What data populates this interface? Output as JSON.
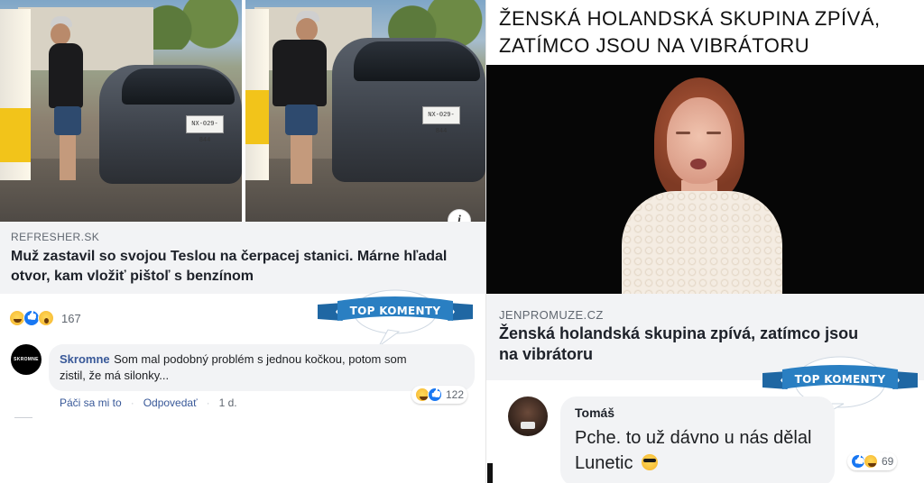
{
  "left_post": {
    "link": {
      "source": "REFRESHER.SK",
      "headline": "Muž zastavil so svojou Teslou na čerpacej stanici. Márne hľadal otvor, kam vložiť pištoľ s benzínom"
    },
    "photo": {
      "plate_left": "NX-029-844",
      "plate_right": "NX-029-844"
    },
    "info_icon": "i",
    "reactions": {
      "icons": [
        "haha-reaction-icon",
        "like-reaction-icon",
        "wow-reaction-icon"
      ],
      "count": "167"
    },
    "top_banner": "TOP KOMENTY",
    "comment": {
      "avatar_text": "SKROMNE",
      "author": "Skromne",
      "text_line1": "Som mal podobný problém s jednou kočkou, potom som",
      "text_line2": "zistil, že má silonky...",
      "actions": {
        "like": "Páči sa mi to",
        "reply": "Odpovedať",
        "time": "1 d."
      },
      "reaction_count": "122"
    }
  },
  "right_post": {
    "title_line1": "ŽENSKÁ HOLANDSKÁ SKUPINA ZPÍVÁ,",
    "title_line2": "ZATÍMCO JSOU NA VIBRÁTORU",
    "link": {
      "source": "JENPROMUZE.CZ",
      "headline_line1": "Ženská holandská skupina zpívá, zatímco jsou",
      "headline_line2": "na vibrátoru"
    },
    "top_banner": "TOP KOMENTY",
    "comment": {
      "author": "Tomáš",
      "text_line1": "Pche. to už dávno u nás dělal",
      "text_line2": "Lunetic",
      "reaction_count": "69"
    }
  },
  "colors": {
    "ribbon_blue": "#2a7fc2",
    "link_blue": "#385898",
    "panel_grey": "#f2f3f5"
  }
}
